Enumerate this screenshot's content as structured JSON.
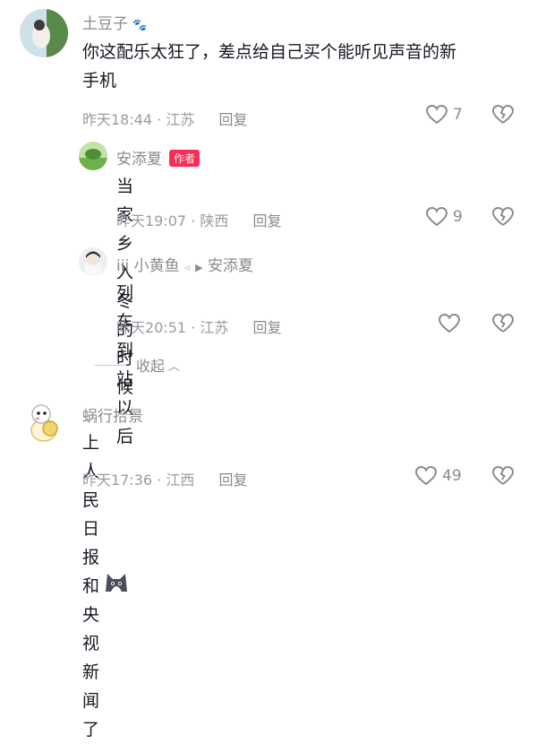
{
  "comments": [
    {
      "user": "土豆子",
      "text_line1": "你这配乐太狂了，差点给自己买个能听见声音的新",
      "text_line2": "手机",
      "time": "昨天18:44",
      "location": "江苏",
      "reply_label": "回复",
      "likes": "7"
    },
    {
      "user": "安添夏",
      "author_badge": "作者",
      "text": "当家乡入冬的时候",
      "time": "昨天19:07",
      "location": "陕西",
      "reply_label": "回复",
      "likes": "9"
    },
    {
      "user": "iii 小黄鱼",
      "reply_to": "安添夏",
      "text": "列车到站以后",
      "time": "昨天20:51",
      "location": "江苏",
      "reply_label": "回复",
      "likes": ""
    },
    {
      "user": "蜗行拾景",
      "text": "上人民日报和央视新闻了",
      "time": "昨天17:36",
      "location": "江西",
      "reply_label": "回复",
      "likes": "49"
    }
  ],
  "collapse_label": "收起",
  "separator": " · ",
  "colors": {
    "accent": "#fe2c55",
    "muted": "#8a8b91",
    "text": "#161823"
  }
}
